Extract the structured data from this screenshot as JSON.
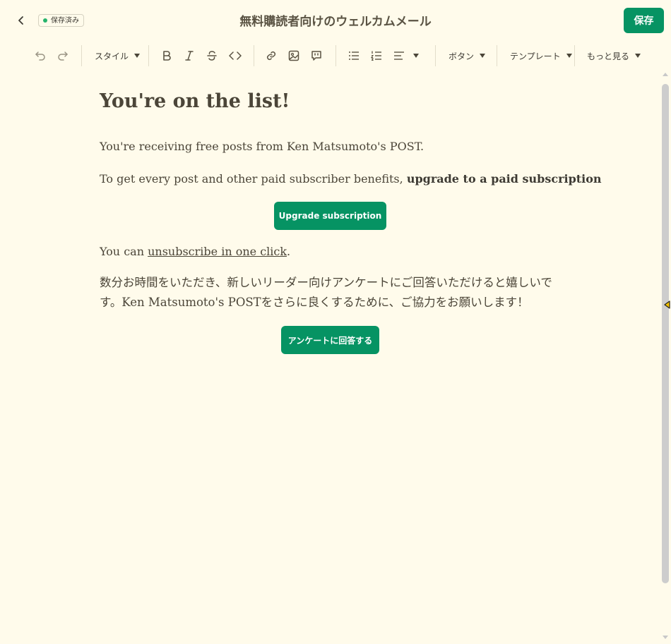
{
  "header": {
    "back_icon": "chevron-left-icon",
    "saved_status": "保存済み",
    "title": "無料購読者向けのウェルカムメール",
    "save_label": "保存",
    "accent_color": "#069363"
  },
  "toolbar": {
    "undo_icon": "undo-icon",
    "redo_icon": "redo-icon",
    "style_label": "スタイル",
    "bold_icon": "bold-icon",
    "italic_icon": "italic-icon",
    "strike_icon": "strikethrough-icon",
    "code_icon": "code-icon",
    "link_icon": "link-icon",
    "image_icon": "image-icon",
    "quote_icon": "quote-bubble-icon",
    "bullet_list_icon": "bullet-list-icon",
    "numbered_list_icon": "numbered-list-icon",
    "align_icon": "align-left-icon",
    "button_label": "ボタン",
    "template_label": "テンプレート",
    "more_label": "もっと見る"
  },
  "content": {
    "heading": "You're on the list!",
    "p1": "You're receiving free posts from Ken Matsumoto's POST.",
    "p2_text": "To get every post and other paid subscriber benefits, ",
    "p2_bold": "upgrade to a paid subscription",
    "upgrade_button": "Upgrade subscription",
    "p3_prefix": "You can ",
    "p3_link": "unsubscribe in one click",
    "p3_suffix": ".",
    "p4": "数分お時間をいただき、新しいリーダー向けアンケートにご回答いただけると嬉しいです。Ken Matsumoto's POSTをさらに良くするために、ご協力をお願いします！",
    "survey_button": "アンケートに回答する"
  }
}
